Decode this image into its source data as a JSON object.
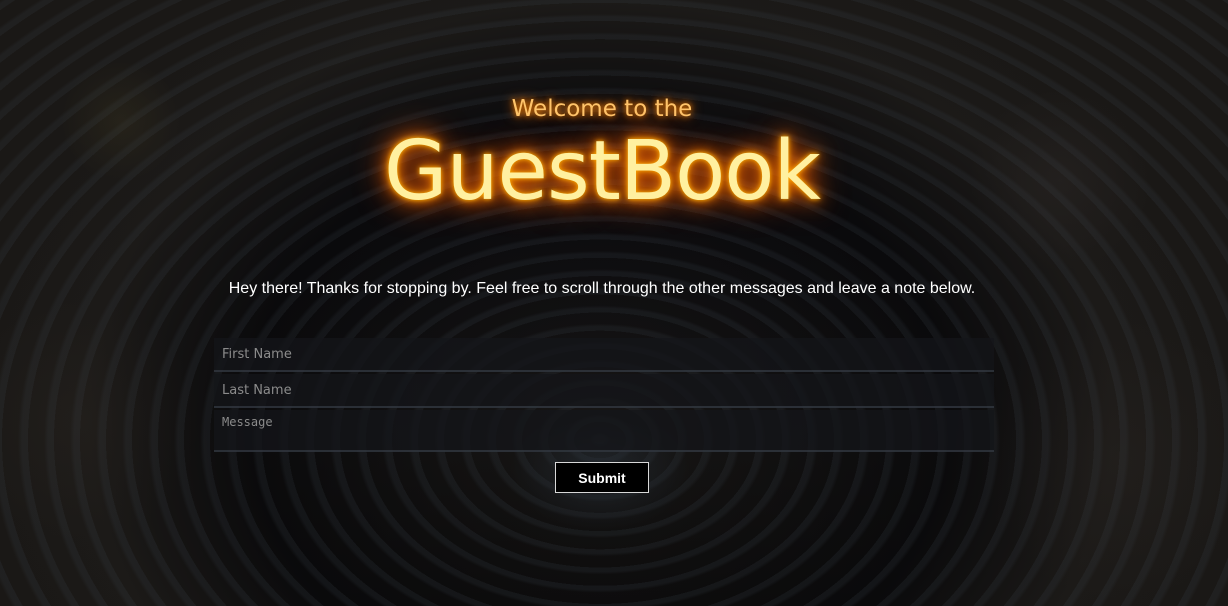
{
  "header": {
    "welcome": "Welcome to the",
    "title": "GuestBook"
  },
  "intro": {
    "text": "Hey there! Thanks for stopping by. Feel free to scroll through the other messages and leave a note below."
  },
  "form": {
    "first_name": {
      "value": "",
      "placeholder": "First Name"
    },
    "last_name": {
      "value": "",
      "placeholder": "Last Name"
    },
    "message": {
      "value": "",
      "placeholder": "Message"
    },
    "submit_label": "Submit"
  },
  "colors": {
    "glow_accent": "#ff8c00",
    "title_text": "#fff0a0",
    "welcome_text": "#ffc46a",
    "button_bg": "#000000",
    "button_border": "#d8d8d8"
  }
}
